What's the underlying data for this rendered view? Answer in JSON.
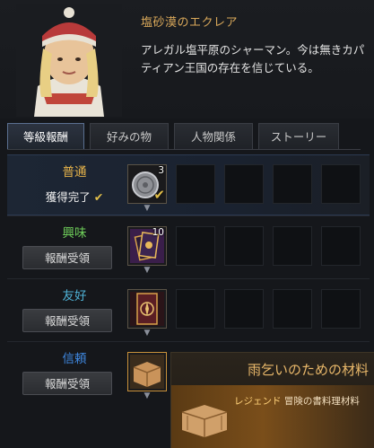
{
  "npc": {
    "name": "塩砂漠のエクレア",
    "description": "アレガル塩平原のシャーマン。今は無きカパティアン王国の存在を信じている。"
  },
  "tabs": [
    {
      "label": "等級報酬",
      "active": true
    },
    {
      "label": "好みの物",
      "active": false
    },
    {
      "label": "人物関係",
      "active": false
    },
    {
      "label": "ストーリー",
      "active": false
    }
  ],
  "tiers": [
    {
      "label": "普通",
      "color": "#e6b34a",
      "status": "獲得完了",
      "reward": {
        "icon": "silver-coin-icon",
        "quantity": "3",
        "claimed": true
      }
    },
    {
      "label": "興味",
      "color": "#6fcf5a",
      "button": "報酬受領",
      "reward": {
        "icon": "card-pack-icon",
        "quantity": "10",
        "claimed": false
      }
    },
    {
      "label": "友好",
      "color": "#4fb2d6",
      "button": "報酬受領",
      "reward": {
        "icon": "compass-card-icon",
        "quantity": "",
        "claimed": false
      }
    },
    {
      "label": "信頼",
      "color": "#3f88e0",
      "button": "報酬受領",
      "reward": {
        "icon": "wooden-crate-icon",
        "quantity": "",
        "claimed": false
      }
    }
  ],
  "tooltip": {
    "title": "雨乞いのための材料",
    "tier": "レジェンド",
    "category": "冒険の書料理材料",
    "icon": "wooden-crate-icon"
  }
}
